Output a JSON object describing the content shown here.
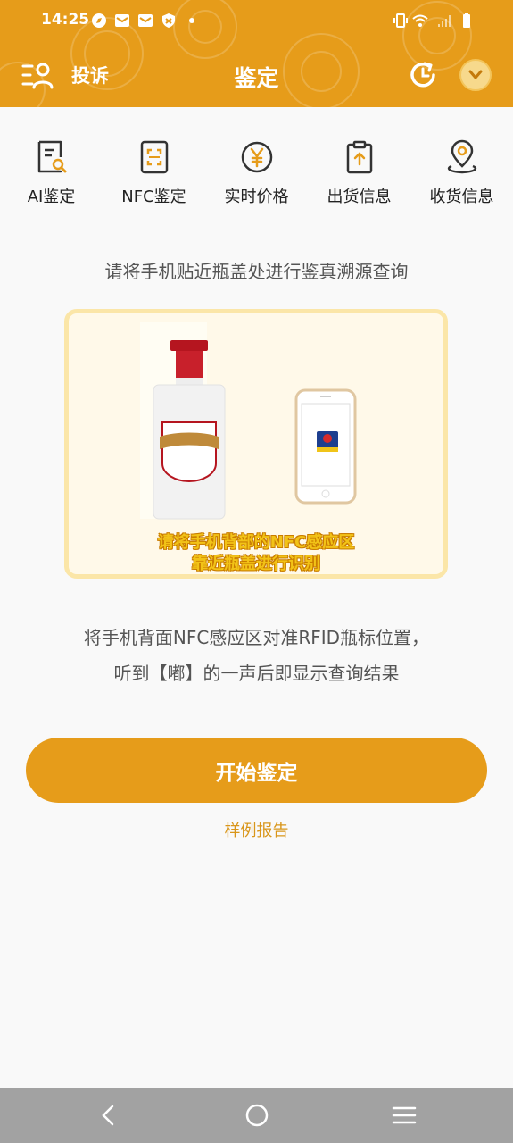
{
  "status_bar": {
    "time": "14:25",
    "left_icons": [
      "compass-icon",
      "mail-icon",
      "mail-icon",
      "shield-icon",
      "dot-icon"
    ],
    "right_icons": [
      "vibrate-icon",
      "wifi-icon",
      "signal-icon",
      "battery-icon"
    ]
  },
  "header": {
    "complaint_label": "投诉",
    "title": "鉴定",
    "left_icon": "user-list-icon",
    "right_icons": [
      "history-icon",
      "chevron-down-icon"
    ],
    "background_color": "#e69c1a"
  },
  "tabs": [
    {
      "label": "AI鉴定",
      "icon": "document-search-icon"
    },
    {
      "label": "NFC鉴定",
      "icon": "nfc-scan-icon"
    },
    {
      "label": "实时价格",
      "icon": "yuan-icon"
    },
    {
      "label": "出货信息",
      "icon": "clipboard-upload-icon"
    },
    {
      "label": "收货信息",
      "icon": "location-pin-icon"
    }
  ],
  "instruction": "请将手机贴近瓶盖处进行鉴真溯源查询",
  "illustration": {
    "caption_line1": "请将手机背部的NFC感应区",
    "caption_line2": "靠近瓶盖进行识别"
  },
  "description": {
    "line1": "将手机背面NFC感应区对准RFID瓶标位置，",
    "line2": "听到【嘟】的一声后即显示查询结果"
  },
  "start_button": "开始鉴定",
  "sample_report": "样例报告",
  "nav": [
    "back-icon",
    "home-icon",
    "menu-icon"
  ],
  "colors": {
    "accent": "#e69c1a",
    "link": "#d9961b",
    "navbar": "#a2a2a2"
  }
}
